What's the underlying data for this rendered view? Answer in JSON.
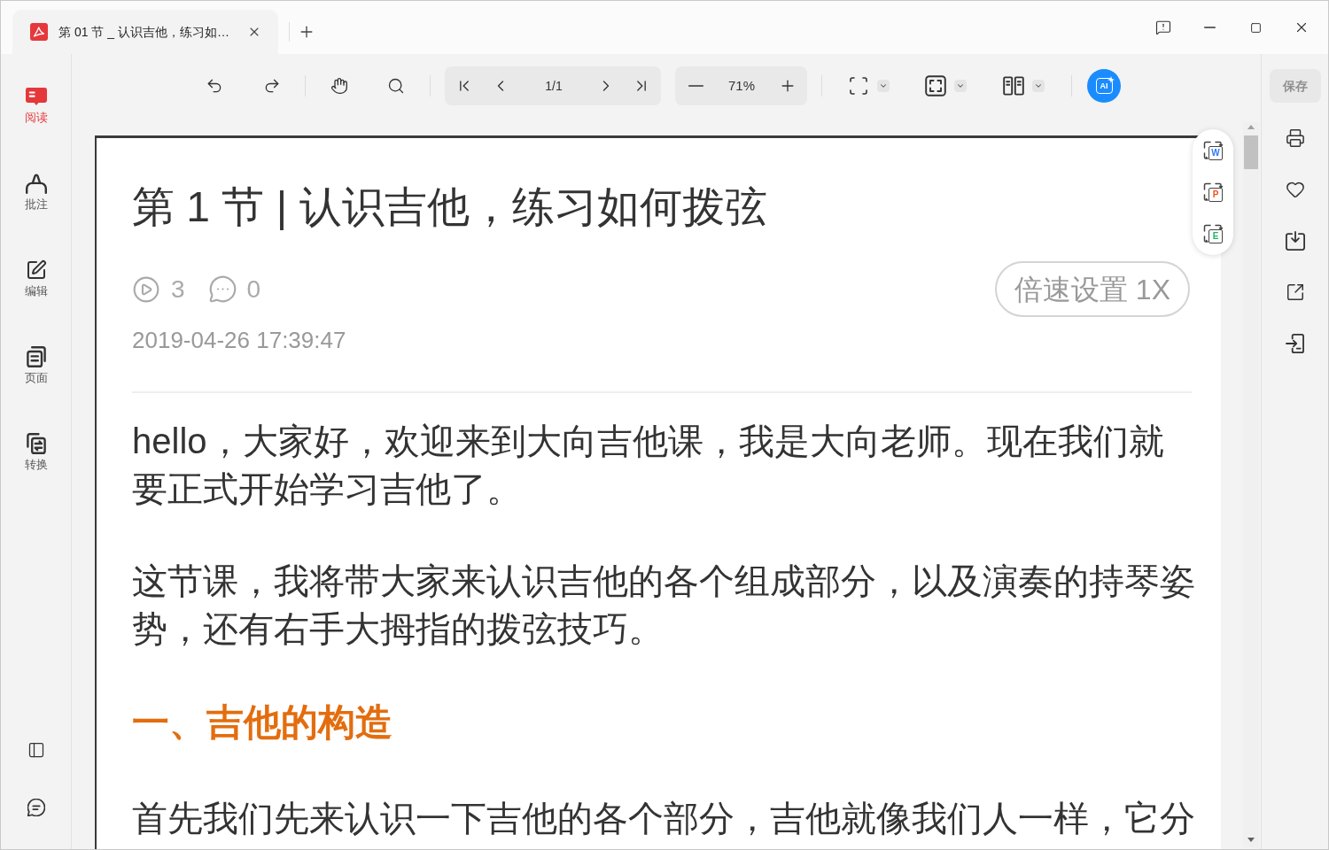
{
  "tabs": [
    {
      "title": "第 01 节 _ 认识吉他，练习如…",
      "selected": true
    }
  ],
  "sidebar": {
    "items": [
      {
        "label": "阅读",
        "selected": true
      },
      {
        "label": "批注",
        "selected": false
      },
      {
        "label": "编辑",
        "selected": false
      },
      {
        "label": "页面",
        "selected": false
      },
      {
        "label": "转换",
        "selected": false
      }
    ]
  },
  "toolbar": {
    "page_number": "1/1",
    "zoom": "71%",
    "ai_button": "AI"
  },
  "document": {
    "title": "第 1 节 | 认识吉他，练习如何拨弦",
    "plays": "3",
    "comments": "0",
    "speed_button": "倍速设置 1X",
    "date": "2019-04-26 17:39:47",
    "blocks": [
      {
        "kind": "paragraph",
        "text": "hello，大家好，欢迎来到大向吉他课，我是大向老师。现在我们就要正式开始学习吉他了。"
      },
      {
        "kind": "paragraph",
        "text": "这节课，我将带大家来认识吉他的各个组成部分，以及演奏的持琴姿势，还有右手大拇指的拨弦技巧。"
      },
      {
        "kind": "heading",
        "text": "一、吉他的构造"
      },
      {
        "kind": "paragraph",
        "text": "首先我们先来认识一下吉他的各个部分，吉他就像我们人一样，它分"
      }
    ]
  },
  "convert_buttons": [
    {
      "letter": "W",
      "color": "#2f7bf5"
    },
    {
      "letter": "P",
      "color": "#f0531c"
    },
    {
      "letter": "E",
      "color": "#22b26a"
    }
  ],
  "right_panel": {
    "save_button": {
      "label": "保存",
      "disabled": true
    }
  }
}
